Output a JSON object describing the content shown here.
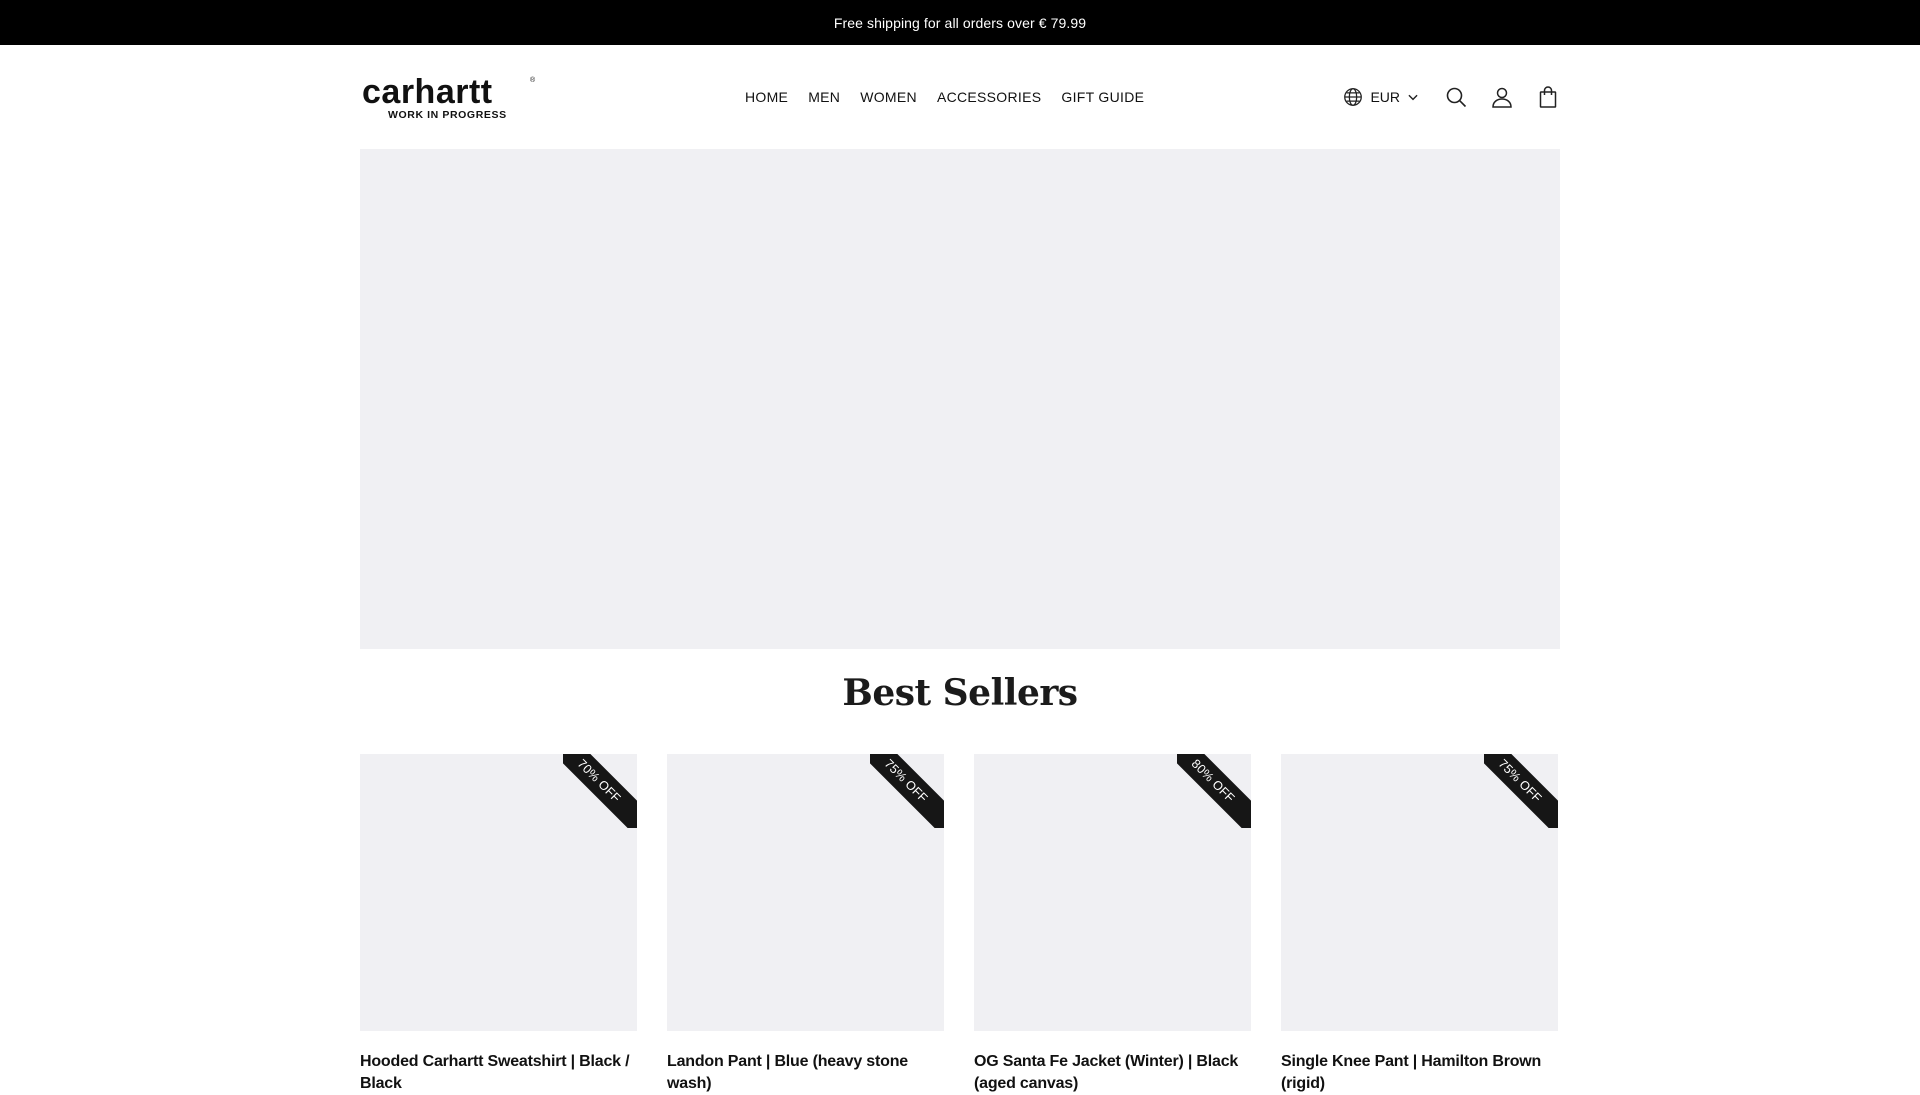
{
  "announcement": "Free shipping for all orders over € 79.99",
  "brand": {
    "wordmark": "carhartt",
    "tagline": "WORK IN PROGRESS",
    "trademark": "®"
  },
  "nav": {
    "items": [
      "HOME",
      "MEN",
      "WOMEN",
      "ACCESSORIES",
      "GIFT GUIDE"
    ]
  },
  "tools": {
    "currency": "EUR",
    "icons": [
      "globe-icon",
      "chevron-down-icon",
      "search-icon",
      "account-icon",
      "cart-bag-icon"
    ]
  },
  "section": {
    "title": "Best Sellers"
  },
  "products": [
    {
      "title": "Hooded Carhartt Sweatshirt | Black / Black",
      "badge": "70% OFF"
    },
    {
      "title": "Landon Pant | Blue (heavy stone wash)",
      "badge": "75% OFF"
    },
    {
      "title": "OG Santa Fe Jacket (Winter) | Black (aged canvas)",
      "badge": "80% OFF"
    },
    {
      "title": "Single Knee Pant | Hamilton Brown (rigid)",
      "badge": "75% OFF"
    }
  ],
  "colors": {
    "announcement_bg": "#000000",
    "placeholder_bg": "#f0f0f3",
    "badge_bg": "#161616",
    "text": "#111111"
  }
}
